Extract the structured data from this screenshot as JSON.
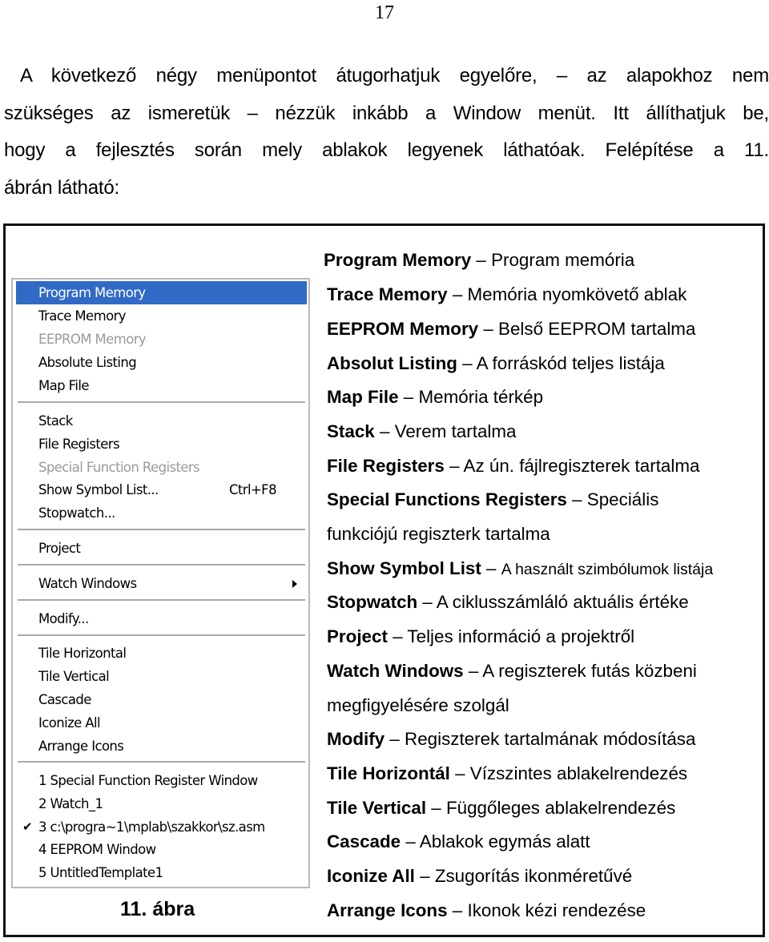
{
  "page_number": "17",
  "intro_lines": [
    "A következő négy menüpontot átugorhatjuk egyelőre, – az alapokhoz nem",
    "szükséges az ismeretük – nézzük inkább a Window menüt. Itt állíthatjuk be,",
    "hogy a fejlesztés során mely ablakok legyenek láthatóak. Felépítése a 11.",
    "ábrán látható:"
  ],
  "figure": {
    "caption": "11. ábra",
    "menu": {
      "highlight_color": "#316ac5",
      "items": [
        {
          "label": "Program Memory",
          "state": "highlighted"
        },
        {
          "label": "Trace Memory",
          "state": "normal"
        },
        {
          "label": "EEPROM Memory",
          "state": "disabled"
        },
        {
          "label": "Absolute Listing",
          "state": "normal"
        },
        {
          "label": "Map File",
          "state": "normal"
        },
        {
          "label": "Stack",
          "state": "normal"
        },
        {
          "label": "File Registers",
          "state": "normal"
        },
        {
          "label": "Special Function Registers",
          "state": "disabled"
        },
        {
          "label": "Show Symbol List...",
          "state": "normal",
          "shortcut": "Ctrl+F8"
        },
        {
          "label": "Stopwatch...",
          "state": "normal"
        },
        {
          "label": "Project",
          "state": "normal"
        },
        {
          "label": "Watch Windows",
          "state": "normal",
          "submenu": true,
          "icon": "submenu-arrow-icon"
        },
        {
          "label": "Modify...",
          "state": "normal"
        },
        {
          "label": "Tile Horizontal",
          "state": "normal"
        },
        {
          "label": "Tile Vertical",
          "state": "normal"
        },
        {
          "label": "Cascade",
          "state": "normal"
        },
        {
          "label": "Iconize All",
          "state": "normal"
        },
        {
          "label": "Arrange Icons",
          "state": "normal"
        },
        {
          "label": "1 Special Function Register Window",
          "state": "normal"
        },
        {
          "label": "2 Watch_1",
          "state": "normal"
        },
        {
          "label": "3 c:\\progra~1\\mplab\\szakkor\\sz.asm",
          "state": "normal",
          "checked": true,
          "check_glyph": "✔"
        },
        {
          "label": "4 EEPROM Window",
          "state": "normal"
        },
        {
          "label": "5 UntitledTemplate1",
          "state": "normal"
        }
      ]
    }
  },
  "descriptions": [
    {
      "term": "Program Memory",
      "sep": " – ",
      "text": "Program memória"
    },
    {
      "term": "Trace Memory",
      "sep": " – ",
      "text": "Memória nyomkövető ablak"
    },
    {
      "term": "EEPROM Memory",
      "sep": " – ",
      "text": "Belső EEPROM tartalma"
    },
    {
      "term": "Absolut Listing",
      "sep": " – ",
      "text": "A forráskód teljes listája"
    },
    {
      "term": "Map File",
      "sep": " – ",
      "text": "Memória térkép"
    },
    {
      "term": "Stack",
      "sep": " – ",
      "text": "Verem tartalma"
    },
    {
      "term": "File Registers",
      "sep": " – ",
      "text": "Az ún. fájlregiszterek tartalma"
    },
    {
      "term": "Special Functions Registers",
      "sep": " – ",
      "text": "Speciális"
    },
    {
      "term": "",
      "sep": "",
      "text": "funkciójú regiszterk tartalma"
    },
    {
      "term": "Show Symbol List",
      "sep": " – ",
      "text": "A használt szimbólumok listája"
    },
    {
      "term": "Stopwatch",
      "sep": " – ",
      "text": "A ciklusszámláló aktuális értéke"
    },
    {
      "term": "Project",
      "sep": " – ",
      "text": "Teljes információ a projektről"
    },
    {
      "term": "Watch Windows",
      "sep": " – ",
      "text": "A regiszterek  futás közbeni"
    },
    {
      "term": "",
      "sep": "",
      "text": "megfigyelésére szolgál"
    },
    {
      "term": "Modify",
      "sep": " – ",
      "text": "Regiszterek tartalmának módosítása"
    },
    {
      "term": "Tile Horizontál",
      "sep": " – ",
      "text": "Vízszintes ablakelrendezés"
    },
    {
      "term": "Tile Vertical",
      "sep": " – ",
      "text": "Függőleges ablakelrendezés"
    },
    {
      "term": "Cascade",
      "sep": " – ",
      "text": "Ablakok egymás alatt"
    },
    {
      "term": "Iconize All",
      "sep": " – ",
      "text": "Zsugorítás ikonméretűvé"
    },
    {
      "term": "Arrange Icons",
      "sep": " – ",
      "text": "Ikonok kézi rendezése"
    }
  ]
}
